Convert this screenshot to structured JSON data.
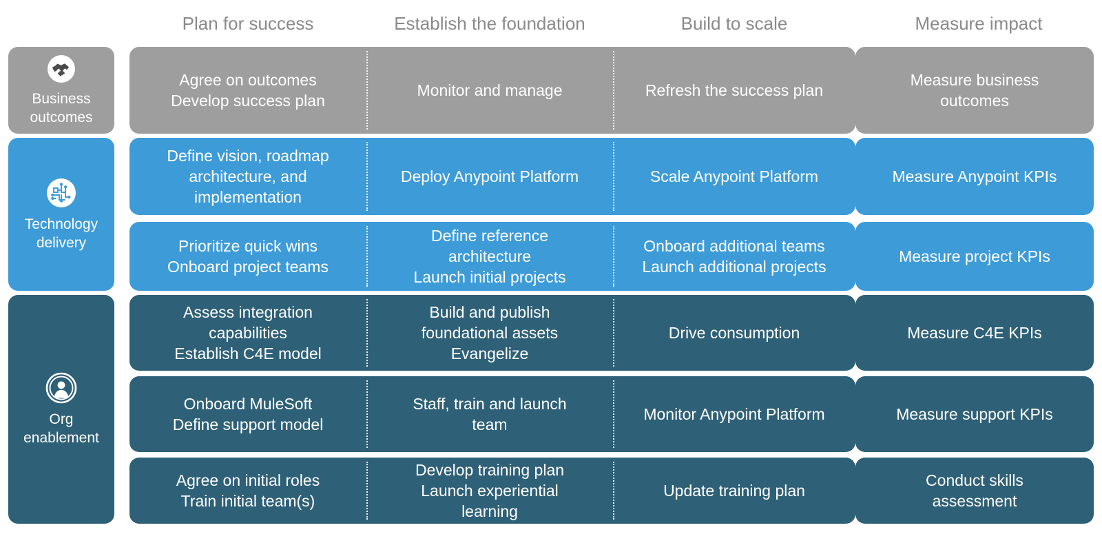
{
  "colors": {
    "business": "#9e9e9e",
    "technology": "#3d9bd8",
    "org": "#2e6077",
    "header_text": "#8a8a8a",
    "cell_text": "#ffffff",
    "background": "#ffffff"
  },
  "columns": [
    {
      "label": "Plan for success"
    },
    {
      "label": "Establish the foundation"
    },
    {
      "label": "Build to scale"
    },
    {
      "label": "Measure impact"
    }
  ],
  "rows": [
    {
      "key": "business-outcomes",
      "label": "Business\noutcomes",
      "icon": "handshake-icon",
      "color": "#9e9e9e",
      "subrows": [
        {
          "cells": [
            "Agree on outcomes\nDevelop success plan",
            "Monitor and manage",
            "Refresh the success plan"
          ],
          "measure": "Measure business\noutcomes"
        }
      ]
    },
    {
      "key": "technology-delivery",
      "label": "Technology\ndelivery",
      "icon": "circuit-icon",
      "color": "#3d9bd8",
      "subrows": [
        {
          "cells": [
            "Define vision, roadmap\narchitecture, and\nimplementation",
            "Deploy Anypoint Platform",
            "Scale Anypoint Platform"
          ],
          "measure": "Measure Anypoint KPIs"
        },
        {
          "cells": [
            "Prioritize quick wins\nOnboard project teams",
            "Define reference\narchitecture\nLaunch initial projects",
            "Onboard additional teams\nLaunch additional projects"
          ],
          "measure": "Measure project KPIs"
        }
      ]
    },
    {
      "key": "org-enablement",
      "label": "Org\nenablement",
      "icon": "person-circle-icon",
      "color": "#2e6077",
      "subrows": [
        {
          "cells": [
            "Assess integration\ncapabilities\nEstablish C4E model",
            "Build and publish\nfoundational assets\nEvangelize",
            "Drive consumption"
          ],
          "measure": "Measure C4E KPIs"
        },
        {
          "cells": [
            "Onboard MuleSoft\nDefine support model",
            "Staff, train and launch\nteam",
            "Monitor Anypoint Platform"
          ],
          "measure": "Measure support KPIs"
        },
        {
          "cells": [
            "Agree on initial roles\nTrain initial team(s)",
            "Develop training plan\nLaunch experiential\nlearning",
            "Update training plan"
          ],
          "measure": "Conduct skills\nassessment"
        }
      ]
    }
  ]
}
